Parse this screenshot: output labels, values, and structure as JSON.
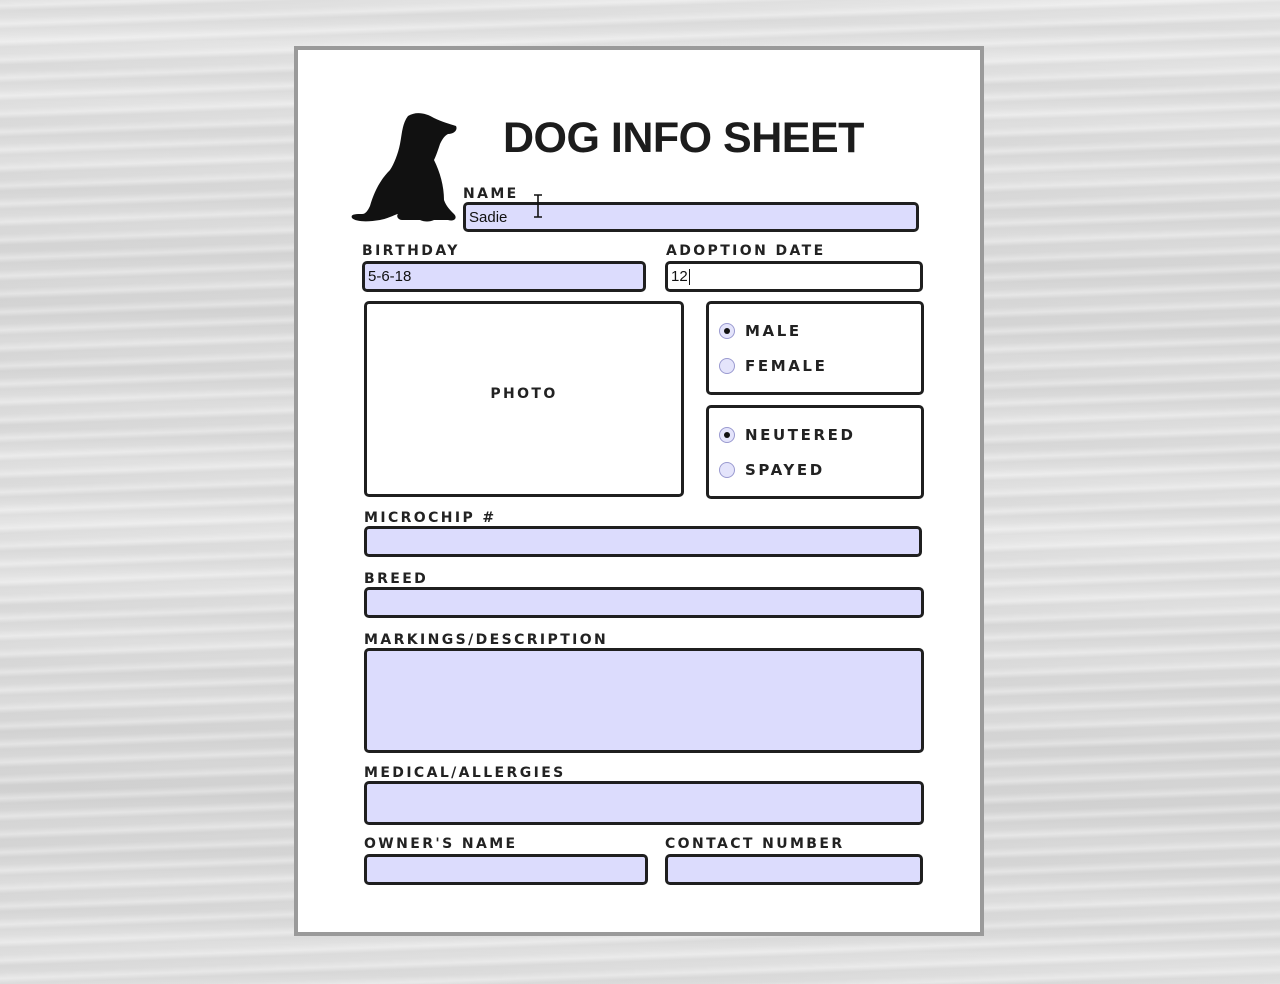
{
  "title": "DOG INFO SHEET",
  "fields": {
    "name": {
      "label": "NAME",
      "value": "Sadie"
    },
    "birthday": {
      "label": "BIRTHDAY",
      "value": "5-6-18"
    },
    "adoption_date": {
      "label": "ADOPTION DATE",
      "value": "12"
    },
    "photo": {
      "label": "PHOTO"
    },
    "microchip": {
      "label": "MICROCHIP #",
      "value": ""
    },
    "breed": {
      "label": "BREED",
      "value": ""
    },
    "markings": {
      "label": "MARKINGS/DESCRIPTION",
      "value": ""
    },
    "medical": {
      "label": "MEDICAL/ALLERGIES",
      "value": ""
    },
    "owner_name": {
      "label": "OWNER'S NAME",
      "value": ""
    },
    "contact_number": {
      "label": "CONTACT NUMBER",
      "value": ""
    }
  },
  "sex": {
    "options": [
      {
        "label": "MALE",
        "selected": true
      },
      {
        "label": "FEMALE",
        "selected": false
      }
    ]
  },
  "fixed": {
    "options": [
      {
        "label": "NEUTERED",
        "selected": true
      },
      {
        "label": "SPAYED",
        "selected": false
      }
    ]
  },
  "icons": {
    "logo": "dog-silhouette-icon",
    "cursor": "text-cursor-icon"
  },
  "colors": {
    "field_fill": "#dcdcfd",
    "border": "#1f1f1f",
    "frame": "#9a9a9a"
  }
}
